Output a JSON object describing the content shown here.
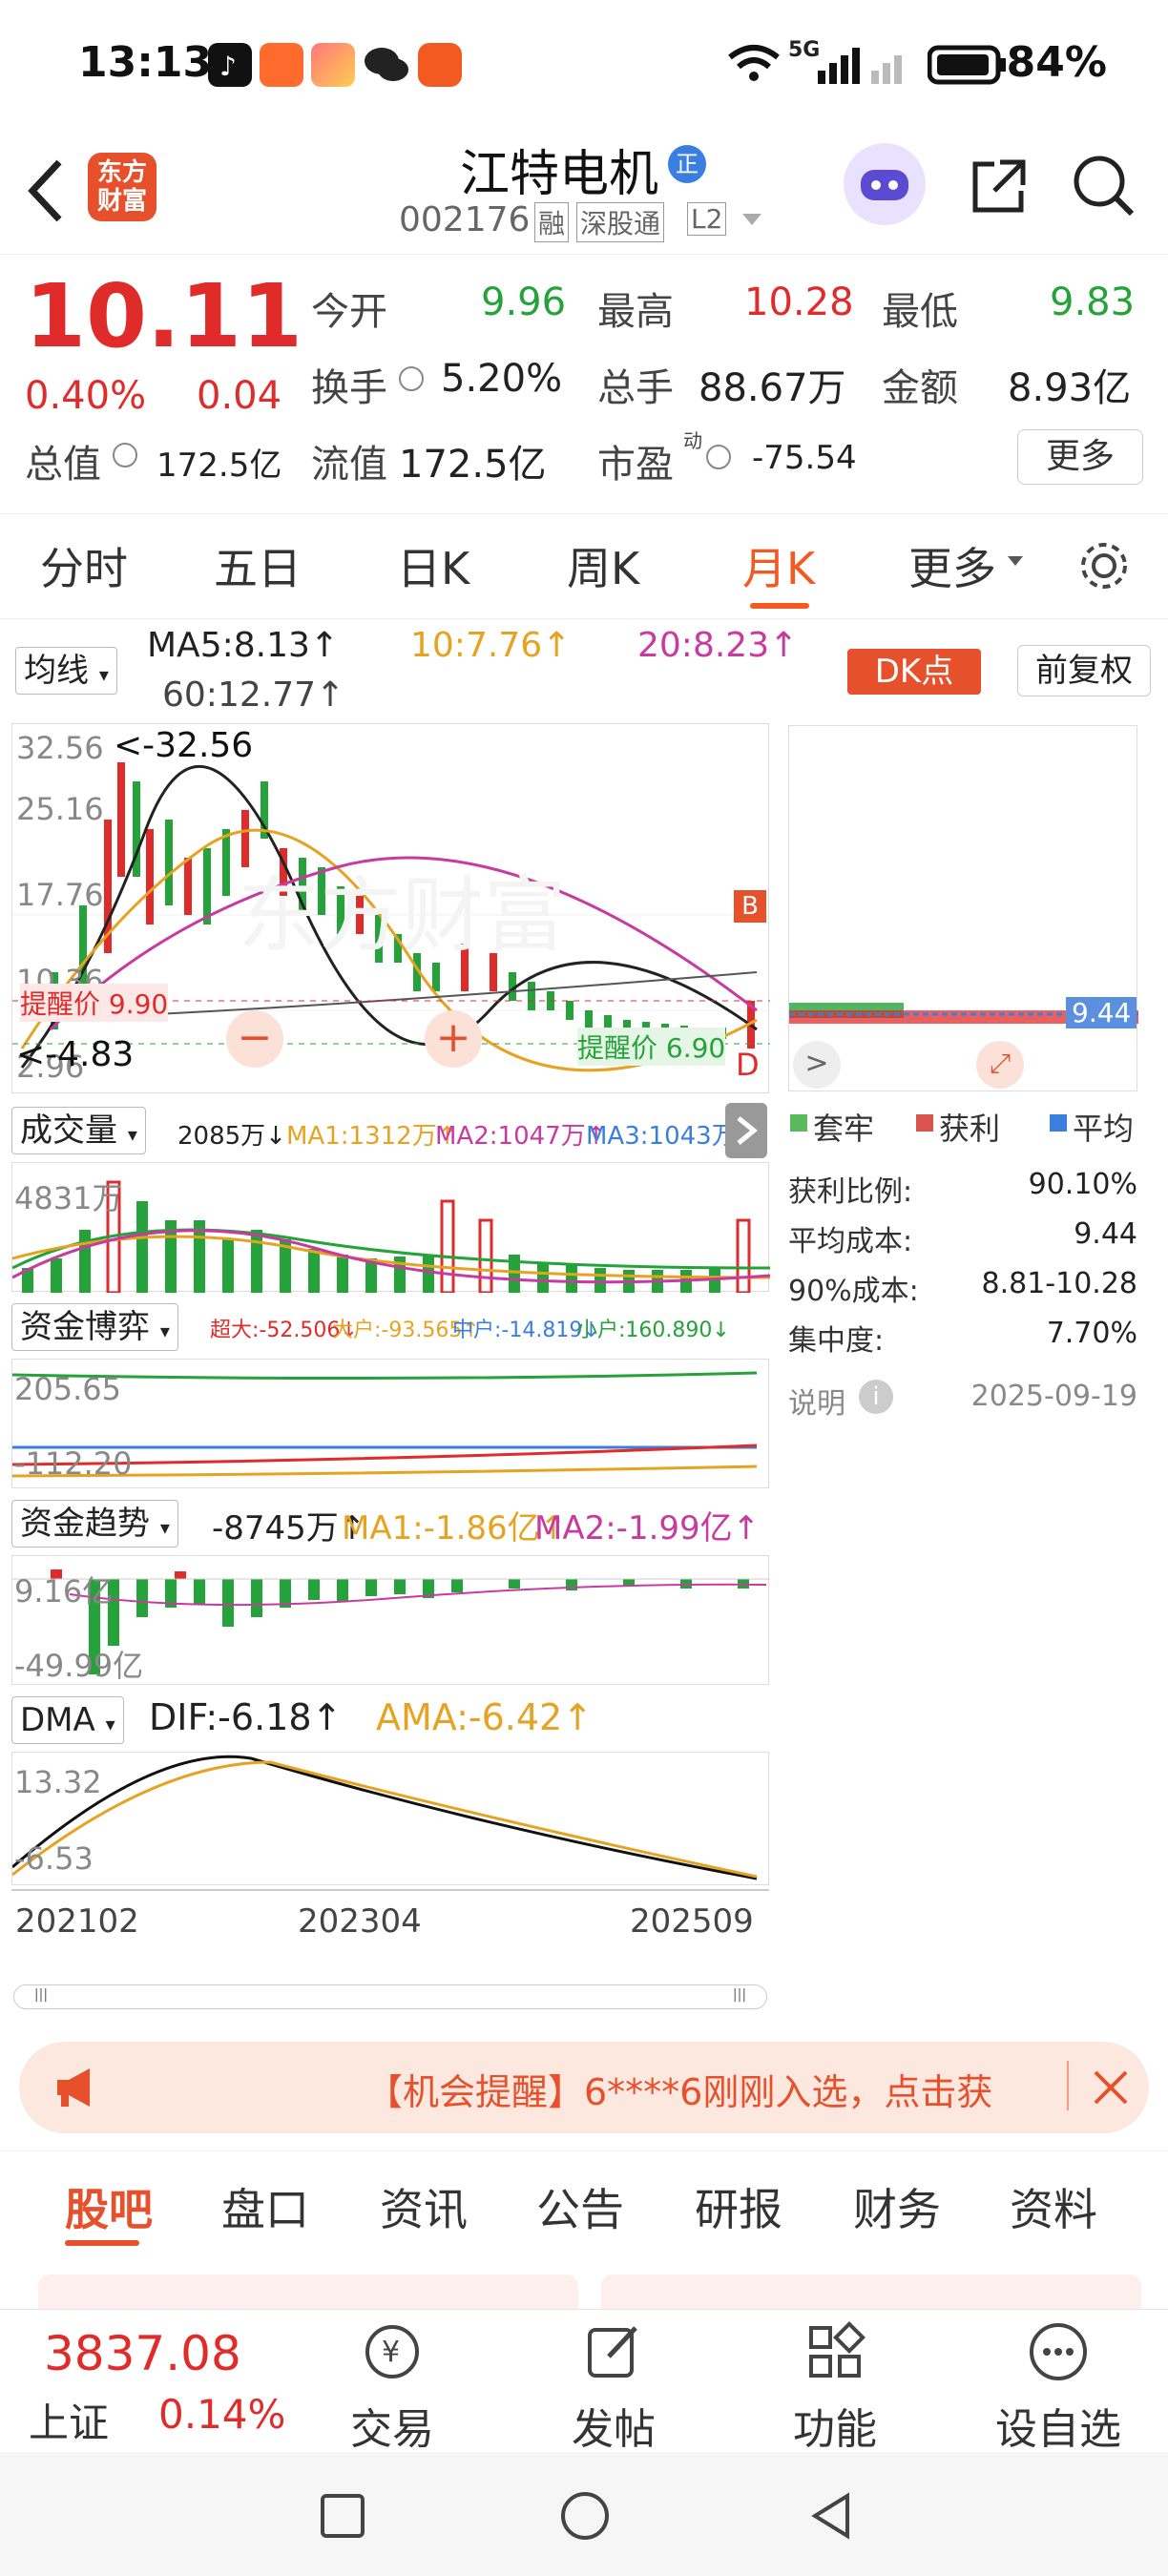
{
  "status": {
    "time": "13:13",
    "network": "5G",
    "battery": "84%"
  },
  "header": {
    "title": "江特电机",
    "badge": "正",
    "code": "002176",
    "tags": [
      "融",
      "深股通",
      "L2"
    ],
    "logo": "东方\n财富"
  },
  "quote": {
    "price": "10.11",
    "change_pct": "0.40%",
    "change": "0.04",
    "open_label": "今开",
    "open": "9.96",
    "high_label": "最高",
    "high": "10.28",
    "low_label": "最低",
    "low": "9.83",
    "turnover_label": "换手",
    "turnover": "5.20%",
    "volume_label": "总手",
    "volume": "88.67万",
    "amount_label": "金额",
    "amount": "8.93亿",
    "mcap_label": "总值",
    "mcap": "172.5亿",
    "float_label": "流值",
    "float": "172.5亿",
    "pe_label": "市盈",
    "pe_sup": "动",
    "pe": "-75.54",
    "more": "更多"
  },
  "period_tabs": [
    "分时",
    "五日",
    "日K",
    "周K",
    "月K",
    "更多"
  ],
  "period_active": "月K",
  "ma_bar": {
    "selector": "均线",
    "ma5": "MA5:8.13↑",
    "ma10": "10:7.76↑",
    "ma20": "20:8.23↑",
    "ma60": "60:12.77↑",
    "dk": "DK点",
    "fq": "前复权"
  },
  "kchart": {
    "y_top": "32.56",
    "y2": "25.16",
    "y3": "17.76",
    "y4": "10.36",
    "max_label": "<-32.56",
    "min_label": "<-4.83",
    "y_bottom": "2.96",
    "alert_high": "提醒价 9.90",
    "alert_low": "提醒价 6.90",
    "b_mark": "B",
    "d_mark": "D",
    "watermark": "东方财富"
  },
  "volume": {
    "selector": "成交量",
    "v": "2085万↓",
    "ma1": "MA1:1312万↑",
    "ma2": "MA2:1047万↑",
    "ma3": "MA3:1043万↓",
    "y_top": "4831万"
  },
  "fund_game": {
    "selector": "资金博弈",
    "super": "超大:-52.506↓",
    "big": "大户:-93.565↑",
    "mid": "中户:-14.819↓",
    "small": "小户:160.890↓",
    "y_top": "205.65",
    "y_bottom": "-112.20"
  },
  "fund_trend": {
    "selector": "资金趋势",
    "v": "-8745万↑",
    "ma1": "MA1:-1.86亿↑",
    "ma2": "MA2:-1.99亿↑",
    "y_top": "9.16亿",
    "y_bottom": "-49.99亿"
  },
  "dma": {
    "selector": "DMA",
    "dif": "DIF:-6.18↑",
    "ama": "AMA:-6.42↑",
    "y_top": "13.32",
    "y_bottom": "-6.53"
  },
  "xaxis": {
    "a": "202102",
    "b": "202304",
    "c": "202509"
  },
  "chip": {
    "price_tag": "9.44",
    "legend": [
      "套牢",
      "获利",
      "平均"
    ],
    "rows": [
      {
        "k": "获利比例:",
        "v": "90.10%"
      },
      {
        "k": "平均成本:",
        "v": "9.44"
      },
      {
        "k": "90%成本:",
        "v": "8.81-10.28"
      },
      {
        "k": "集中度:",
        "v": "7.70%"
      }
    ],
    "note": "说明",
    "date": "2025-09-19"
  },
  "banner": {
    "text": "【机会提醒】6****6刚刚入选，点击获"
  },
  "bottom_tabs": [
    "股吧",
    "盘口",
    "资讯",
    "公告",
    "研报",
    "财务",
    "资料"
  ],
  "bottom_active": "股吧",
  "index": {
    "value": "3837.08",
    "name": "上证",
    "pct": "0.14%"
  },
  "nav": [
    "交易",
    "发帖",
    "功能",
    "设自选"
  ]
}
